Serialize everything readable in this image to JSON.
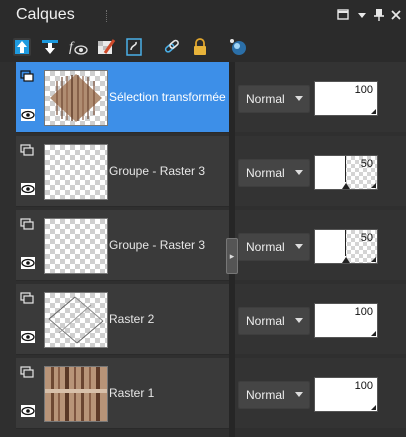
{
  "panel": {
    "title": "Calques",
    "controls": [
      "maximize-icon",
      "dropdown-icon",
      "pin-icon",
      "close-icon"
    ]
  },
  "toolbar": {
    "tools": [
      "new-raster-layer-icon",
      "new-layer-down-icon",
      "layer-visibility-icon",
      "new-mask-icon",
      "layer-properties-icon",
      "link-icon",
      "lock-icon",
      "layer-style-icon"
    ]
  },
  "layers": [
    {
      "name": "Sélection transformée",
      "blend_mode": "Normal",
      "opacity": 100,
      "selected": true,
      "thumbnail": "brown-striped-diamond"
    },
    {
      "name": "Groupe - Raster 3",
      "blend_mode": "Normal",
      "opacity": 50,
      "selected": false,
      "thumbnail": "transparent"
    },
    {
      "name": "Groupe - Raster 3",
      "blend_mode": "Normal",
      "opacity": 50,
      "selected": false,
      "thumbnail": "transparent"
    },
    {
      "name": "Raster 2",
      "blend_mode": "Normal",
      "opacity": 100,
      "selected": false,
      "thumbnail": "grey-lines"
    },
    {
      "name": "Raster 1",
      "blend_mode": "Normal",
      "opacity": 100,
      "selected": false,
      "thumbnail": "brown-stripes"
    }
  ],
  "colors": {
    "selection": "#3d8fe8",
    "panel_bg": "#2f2f2f",
    "thumb_brown": "#b08d72"
  }
}
